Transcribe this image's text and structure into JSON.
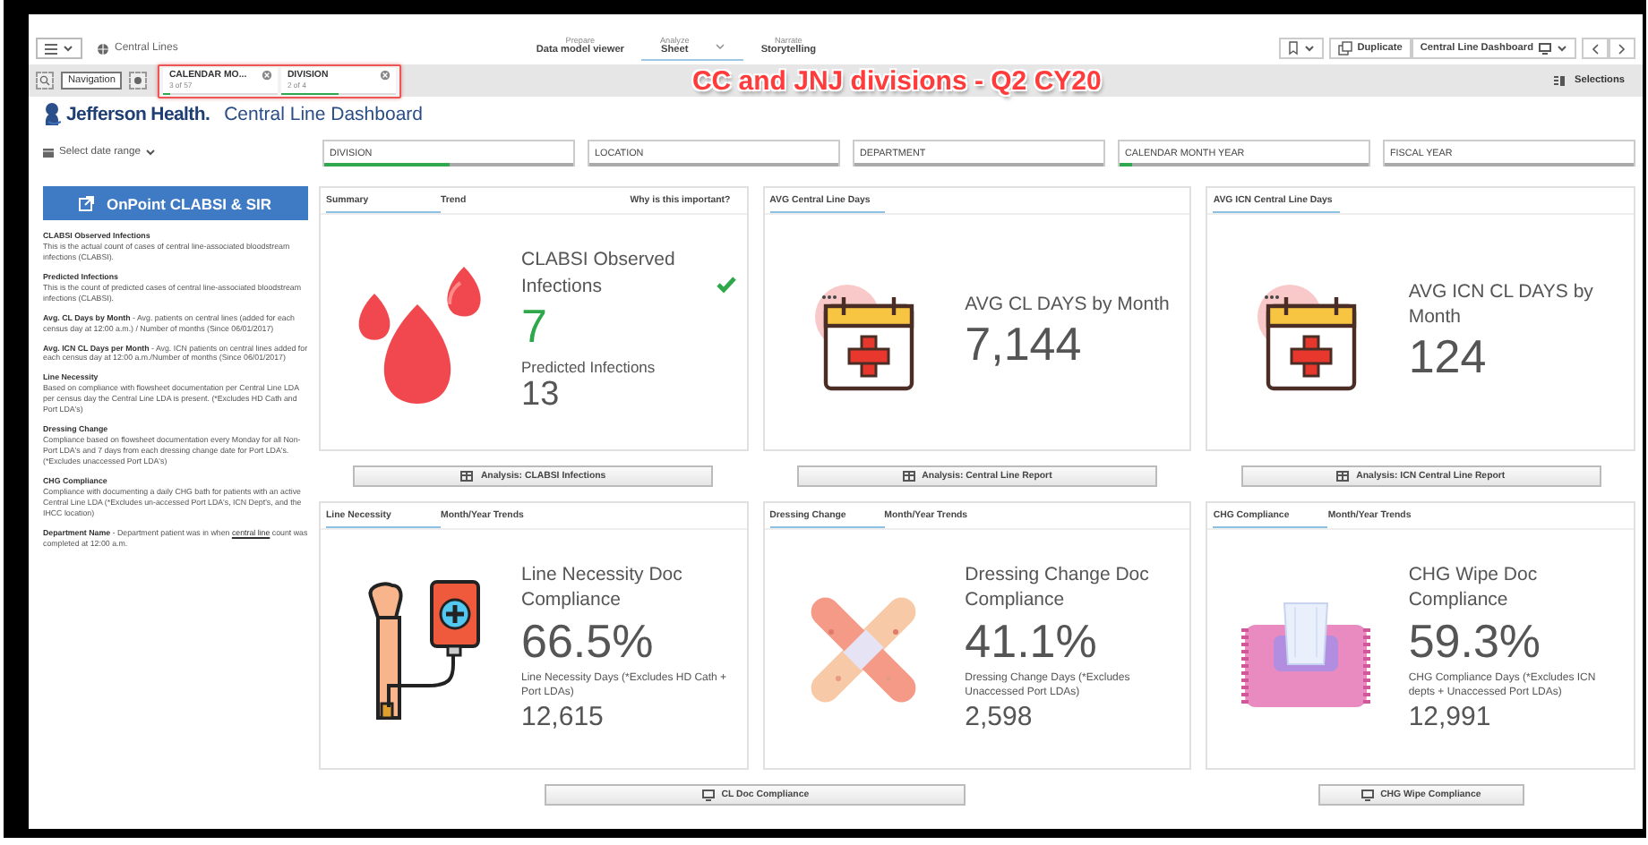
{
  "top_bar": {
    "app_title": "Central Lines",
    "tabs": [
      {
        "caption": "Prepare",
        "label": "Data model viewer",
        "selected": false,
        "dropdown": false
      },
      {
        "caption": "Analyze",
        "label": "Sheet",
        "selected": true,
        "dropdown": true
      },
      {
        "caption": "Narrate",
        "label": "Storytelling",
        "selected": false,
        "dropdown": false
      }
    ],
    "duplicate": "Duplicate",
    "sheet": "Central Line Dashboard"
  },
  "selection_bar": {
    "tooltip": "Navigation",
    "chips": [
      {
        "field": "CALENDAR MO...",
        "count": "3 of 57",
        "level": 0.05
      },
      {
        "field": "DIVISION",
        "count": "2 of 4",
        "level": 0.5
      }
    ],
    "annotation": "CC and JNJ divisions - Q2 CY20",
    "selections": "Selections"
  },
  "header": {
    "logo": "Jefferson Health.",
    "title": "Central Line Dashboard",
    "date_range": "Select date range"
  },
  "filters": [
    {
      "label": "DIVISION",
      "level": 0.5
    },
    {
      "label": "LOCATION",
      "level": 0
    },
    {
      "label": "DEPARTMENT",
      "level": 0
    },
    {
      "label": "CALENDAR MONTH YEAR",
      "level": 0.05
    },
    {
      "label": "FISCAL YEAR",
      "level": 0
    }
  ],
  "sidebar": {
    "button": "OnPoint CLABSI & SIR",
    "definitions": [
      {
        "kind": "block",
        "term": "CLABSI Observed Infections",
        "text": "This is the actual count of cases of central line-associated bloodstream infections (CLABSI)."
      },
      {
        "kind": "block",
        "term": "Predicted Infections",
        "text": "This is the count of predicted cases of central line-associated bloodstream infections (CLABSI)."
      },
      {
        "kind": "inline",
        "term": "Avg. CL Days by Month",
        "text": "- Avg. patients on central lines (added for each census day at 12:00 a.m.) / Number of months (Since 06/01/2017)"
      },
      {
        "kind": "inline",
        "term": "Avg. ICN CL Days per Month",
        "text": "- Avg. ICN patients on central lines added for each census day at 12:00 a.m./Number of months (Since 06/01/2017)"
      },
      {
        "kind": "block",
        "term": "Line Necessity",
        "text": "Based on compliance with flowsheet documentation per Central Line LDA per census day the Central Line LDA is present. (*Excludes HD Cath and Port LDA's)"
      },
      {
        "kind": "block",
        "term": "Dressing Change",
        "text": "Compliance based on flowsheet documentation every Monday for all Non-Port LDA's and 7 days from each dressing change date for Port LDA's. (*Excludes unaccessed Port LDA's)"
      },
      {
        "kind": "block",
        "term": "CHG Compliance",
        "text": "Compliance with documenting a daily CHG bath for patients with an active Central Line LDA (*Excludes un-accessed Port LDA's, ICN Dept's, and the IHCC location)"
      }
    ],
    "note": {
      "term": "Department Name",
      "text_before": " - Department patient was in when ",
      "link": "central line",
      "text_after": " count was completed at 12:00 a.m."
    }
  },
  "cards": [
    {
      "kind": "drops",
      "tabs": [
        {
          "label": "Summary",
          "selected": true
        },
        {
          "label": "Trend",
          "selected": false
        },
        {
          "label": "Why is this important?",
          "selected": false
        }
      ],
      "title": "CLABSI Observed Infections",
      "check": true,
      "value": "7",
      "color": "#2ea84a",
      "sub_label": "Predicted Infections",
      "sub_value": "13"
    },
    {
      "kind": "calendar",
      "tabs": [
        {
          "label": "AVG Central Line Days",
          "selected": true
        }
      ],
      "title": "AVG CL DAYS by Month",
      "check": false,
      "value": "7,144",
      "color": "#555555"
    },
    {
      "kind": "calendar",
      "tabs": [
        {
          "label": "AVG ICN Central Line Days",
          "selected": true
        }
      ],
      "title": "AVG ICN CL DAYS by Month",
      "check": false,
      "value": "124",
      "color": "#555555"
    },
    {
      "kind": "iv",
      "tabs": [
        {
          "label": "Line Necessity",
          "selected": true
        },
        {
          "label": "Month/Year Trends",
          "selected": false
        }
      ],
      "title": "Line Necessity Doc Compliance",
      "check": false,
      "value": "66.5%",
      "color": "#555555",
      "note": "Line Necessity Days (*Excludes HD Cath + Port LDAs)",
      "note_value": "12,615"
    },
    {
      "kind": "bandage",
      "tabs": [
        {
          "label": "Dressing Change",
          "selected": true
        },
        {
          "label": "Month/Year Trends",
          "selected": false
        }
      ],
      "title": "Dressing Change Doc Compliance",
      "check": false,
      "value": "41.1%",
      "color": "#555555",
      "note": "Dressing Change Days (*Excludes Unaccessed Port LDAs)",
      "note_value": "2,598"
    },
    {
      "kind": "wipes",
      "tabs": [
        {
          "label": "CHG Compliance",
          "selected": true
        },
        {
          "label": "Month/Year Trends",
          "selected": false
        }
      ],
      "title": "CHG Wipe Doc Compliance",
      "check": false,
      "value": "59.3%",
      "color": "#555555",
      "note": "CHG Compliance Days (*Excludes ICN depts + Unaccessed Port LDAs)",
      "note_value": "12,991"
    }
  ],
  "buttons": [
    {
      "kind": "table",
      "label": "Analysis: CLABSI Infections"
    },
    {
      "kind": "table",
      "label": "Analysis: Central Line Report"
    },
    {
      "kind": "table",
      "label": "Analysis: ICN Central Line Report"
    }
  ],
  "buttons_row2": [
    {
      "kind": "monitor",
      "label": "CL Doc Compliance"
    },
    {
      "kind": "monitor",
      "label": "CHG Wipe Compliance"
    }
  ]
}
